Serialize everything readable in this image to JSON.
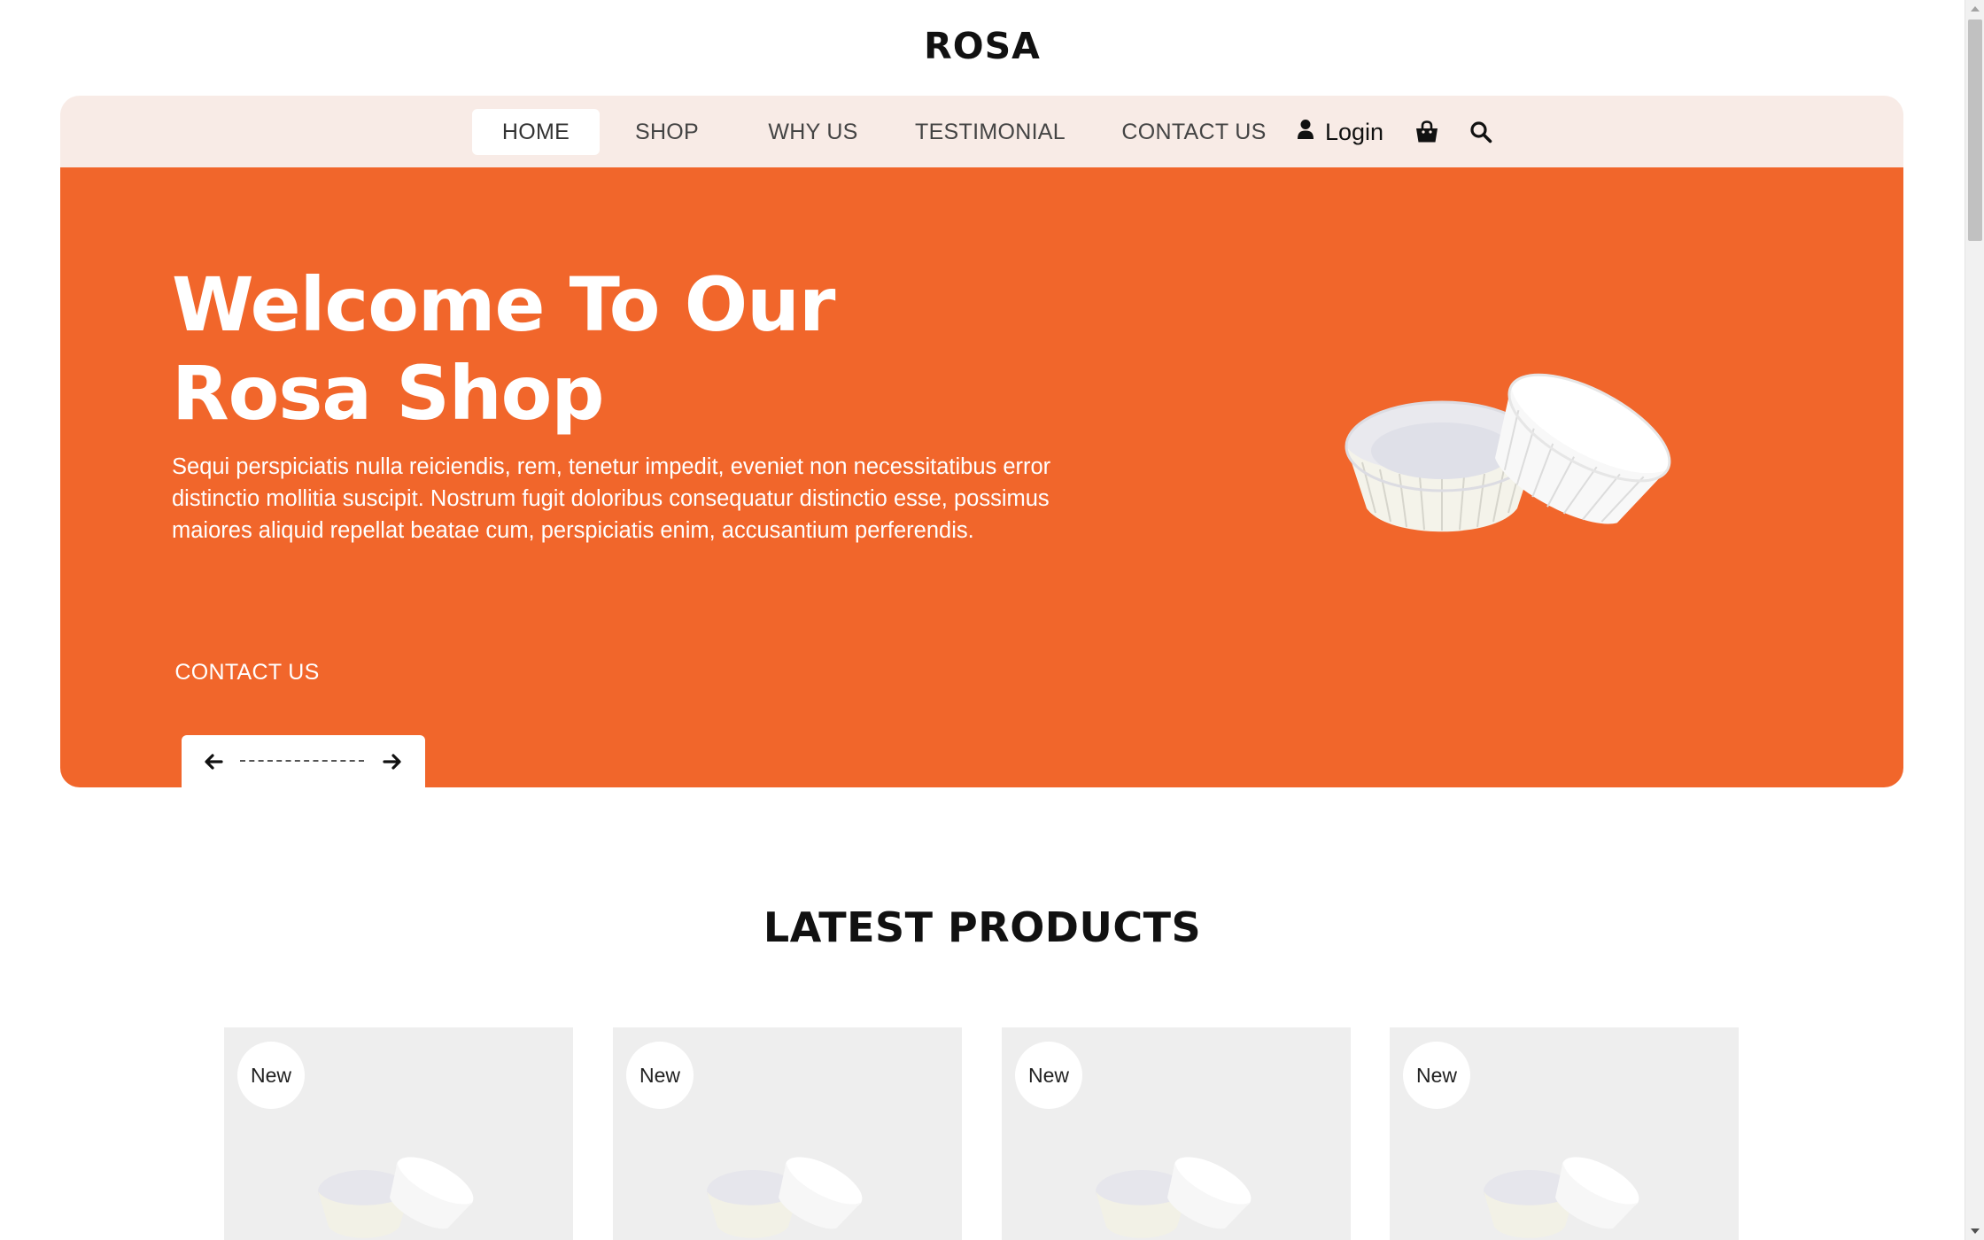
{
  "brand": "ROSA",
  "nav": {
    "items": [
      {
        "label": "HOME",
        "active": true
      },
      {
        "label": "SHOP",
        "active": false
      },
      {
        "label": "WHY US",
        "active": false
      },
      {
        "label": "TESTIMONIAL",
        "active": false
      },
      {
        "label": "CONTACT US",
        "active": false
      }
    ],
    "login_label": "Login",
    "icons": [
      "user-icon",
      "shopping-bag-icon",
      "search-icon"
    ]
  },
  "hero": {
    "title_line1": "Welcome To Our",
    "title_line2": "Rosa Shop",
    "text": "Sequi perspiciatis nulla reiciendis, rem, tenetur impedit, eveniet non necessitatibus error distinctio mollitia suscipit. Nostrum fugit doloribus consequatur distinctio esse, possimus maiores aliquid repellat beatae cum, perspiciatis enim, accusantium perferendis.",
    "button_label": "CONTACT US",
    "image": "cupcake-liners-image",
    "slider_icons": [
      "arrow-left-icon",
      "arrow-right-icon"
    ]
  },
  "latest": {
    "title": "LATEST PRODUCTS",
    "products": [
      {
        "badge": "New",
        "image": "cupcake-liners-image"
      },
      {
        "badge": "New",
        "image": "cupcake-liners-image"
      },
      {
        "badge": "New",
        "image": "cupcake-liners-image"
      },
      {
        "badge": "New",
        "image": "cupcake-liners-image"
      }
    ]
  },
  "colors": {
    "accent": "#f1662b",
    "nav_bg": "#f8ebe6",
    "card_bg": "#eeeeee"
  }
}
